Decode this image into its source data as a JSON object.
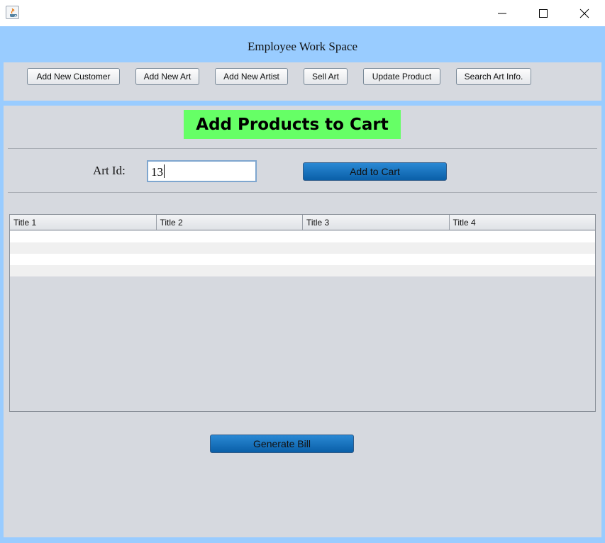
{
  "window": {
    "icons": [
      "java-app-icon",
      "minimize-icon",
      "maximize-icon",
      "close-icon"
    ]
  },
  "header": {
    "title": "Employee Work Space"
  },
  "toolbar": {
    "buttons": [
      "Add New Customer",
      "Add New Art",
      "Add New Artist",
      "Sell Art",
      "Update Product",
      "Search Art Info."
    ]
  },
  "cart": {
    "banner": "Add Products to Cart",
    "art_id_label": "Art Id:",
    "art_id_value": "13",
    "add_button": "Add to Cart",
    "generate_button": "Generate Bill"
  },
  "table": {
    "columns": [
      "Title 1",
      "Title 2",
      "Title 3",
      "Title 4"
    ],
    "rows": [
      [
        "",
        "",
        "",
        ""
      ],
      [
        "",
        "",
        "",
        ""
      ],
      [
        "",
        "",
        "",
        ""
      ],
      [
        "",
        "",
        "",
        ""
      ]
    ]
  },
  "colors": {
    "frame": "#99ccff",
    "panel": "#d6d9df",
    "banner": "#66ff66",
    "action_button": "#0a5fa8"
  }
}
